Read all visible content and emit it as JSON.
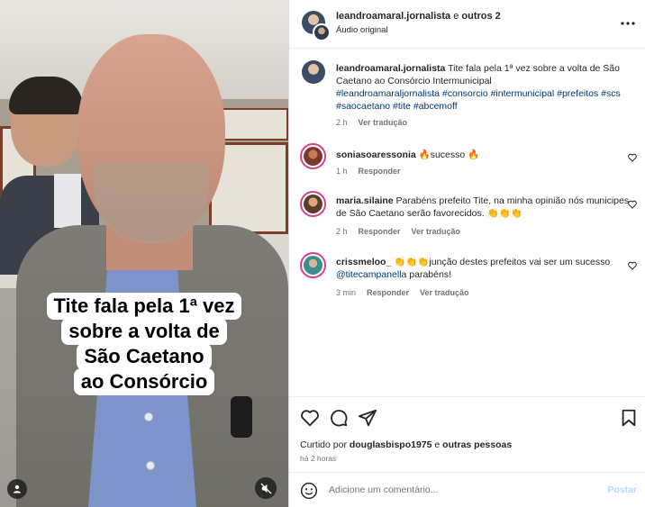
{
  "video": {
    "caption_lines": [
      "Tite fala pela 1ª vez",
      "sobre a volta de",
      "São Caetano",
      "ao Consórcio"
    ],
    "tag_icon": "user-icon",
    "mute_icon": "speaker-muted-icon"
  },
  "header": {
    "author": "leandroamaral.jornalista",
    "joiner": " e ",
    "others": "outros 2",
    "audio": "Áudio original",
    "more_icon": "more-horizontal-icon"
  },
  "caption_comment": {
    "author": "leandroamaral.jornalista",
    "text": " Tite fala pela 1ª vez sobre a volta de São Caetano ao Consórcio Intermunicipal",
    "hashtags": "#leandroamaraljornalista #consorcio #intermunicipal #prefeitos #scs #saocaetano #tite #abcemoff",
    "time": "2 h",
    "translate": "Ver tradução"
  },
  "comments": [
    {
      "author": "soniasoaressonia",
      "text": " 🔥sucesso 🔥",
      "time": "1 h",
      "reply": "Responder",
      "translate": ""
    },
    {
      "author": "maria.silaine",
      "text": " Parabéns prefeito Tite, na minha opinião nós municipes de São Caetano serão favorecidos. 👏👏👏",
      "time": "2 h",
      "reply": "Responder",
      "translate": "Ver tradução"
    },
    {
      "author": "crissmeloo_",
      "text": " 👏👏👏junção destes prefeitos vai ser um sucesso ",
      "mention": "@titecampanella",
      "text_end": " parabéns!",
      "time": "3 min",
      "reply": "Responder",
      "translate": "Ver tradução"
    }
  ],
  "actions": {
    "liked_by_prefix": "Curtido por ",
    "liked_by_user": "douglasbispo1975",
    "liked_by_suffix": " e ",
    "liked_by_others": "outras pessoas",
    "time_ago": "há 2 horas"
  },
  "composer": {
    "placeholder": "Adicione um comentário...",
    "post_label": "Postar"
  },
  "colors": {
    "link": "#00376b",
    "muted": "#737373",
    "post_disabled": "#b3dbff",
    "story_ring": "#d93f8b"
  }
}
